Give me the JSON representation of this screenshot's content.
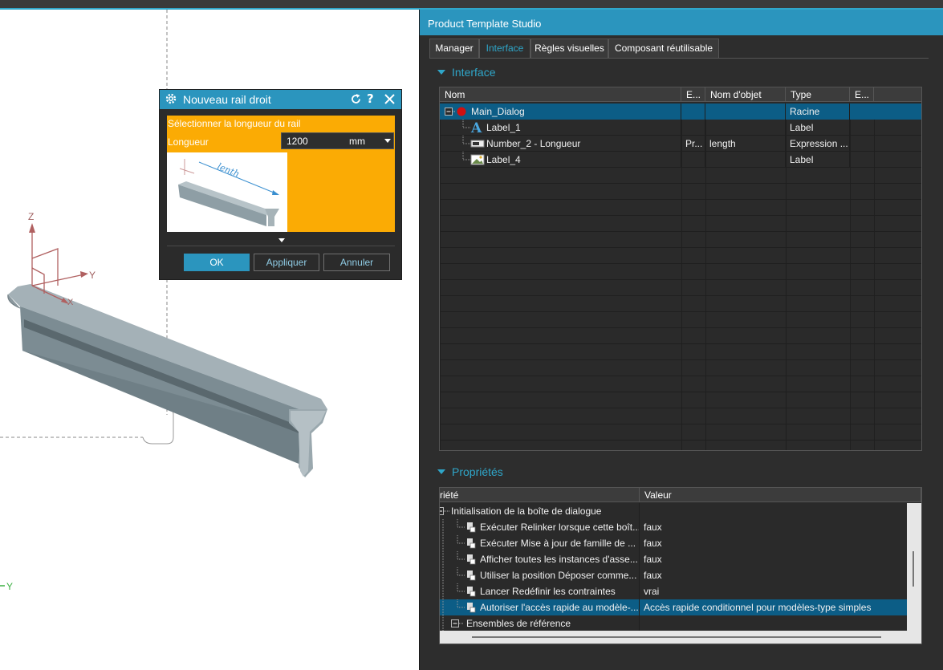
{
  "viewport": {
    "axis_z": "Z",
    "axis_y": "Y",
    "axis_x": "X",
    "triad_y": "Y"
  },
  "dialog": {
    "title": "Nouveau rail droit",
    "prompt": "Sélectionner la longueur du rail",
    "length_label": "Longueur",
    "length_value": "1200",
    "unit": "mm",
    "image_caption": "lenth",
    "ok": "OK",
    "apply": "Appliquer",
    "cancel": "Annuler",
    "colors": {
      "title_bar": "#2b95be",
      "prompt_bg": "#fbab04"
    }
  },
  "panel": {
    "title": "Product Template Studio",
    "tabs": [
      "Manager",
      "Interface",
      "Règles visuelles",
      "Composant réutilisable"
    ],
    "active_tab": "Interface",
    "interface_section": "Interface",
    "properties_section": "Propriétés"
  },
  "interface_table": {
    "columns": [
      "Nom",
      "E...",
      "Nom d'objet",
      "Type",
      "E..."
    ],
    "rows": [
      {
        "name": "Main_Dialog",
        "e": "",
        "object": "",
        "type": "Racine",
        "icon": "red-circle-icon",
        "selected": true
      },
      {
        "name": "Label_1",
        "e": "",
        "object": "",
        "type": "Label",
        "icon": "label-a-icon"
      },
      {
        "name": "Number_2 - Longueur",
        "e": "Pr...",
        "object": "length",
        "type": "Expression ...",
        "icon": "number-field-icon"
      },
      {
        "name": "Label_4",
        "e": "",
        "object": "",
        "type": "Label",
        "icon": "image-label-icon"
      }
    ]
  },
  "properties_table": {
    "columns": [
      "riété",
      "Valeur"
    ],
    "group": "Initialisation de la boîte de dialogue",
    "rows": [
      {
        "name": "Exécuter Relinker lorsque cette boît...",
        "value": "faux"
      },
      {
        "name": "Exécuter Mise à jour de famille de ...",
        "value": "faux"
      },
      {
        "name": "Afficher toutes les instances d'asse...",
        "value": "faux"
      },
      {
        "name": "Utiliser la position Déposer comme...",
        "value": "faux"
      },
      {
        "name": "Lancer Redéfinir les contraintes",
        "value": "vrai"
      },
      {
        "name": "Autoriser l'accès rapide au modèle-...",
        "value": "Accès rapide conditionnel pour modèles-type simples",
        "selected": true
      }
    ],
    "group2": "Ensembles de référence"
  }
}
